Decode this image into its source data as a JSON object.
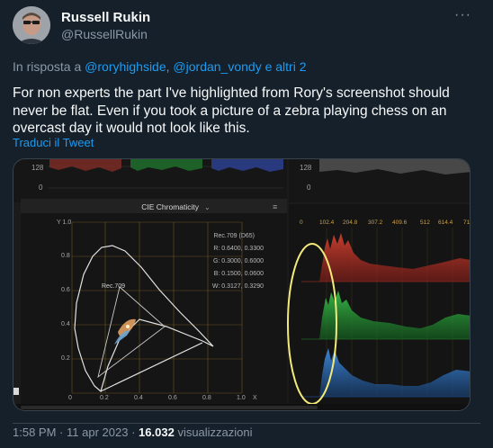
{
  "tweet": {
    "author_name": "Russell Rukin",
    "author_handle": "@RussellRukin",
    "more_glyph": "···",
    "reply_prefix": "In risposta a",
    "reply_mention_1": "@roryhighside",
    "reply_sep": ",",
    "reply_mention_2": "@jordan_vondy",
    "reply_suffix": "e altri 2",
    "text": "For non experts the part I've highlighted from Rory's screenshot should never be flat. Even if you took a picture of a zebra playing chess on an overcast day it would not look like this.",
    "translate_label": "Traduci il Tweet",
    "time": "1:58 PM",
    "date": "11 apr 2023",
    "meta_sep": "·",
    "views_count": "16.032",
    "views_label": "visualizzazioni"
  },
  "screenshot": {
    "left_top_scale": [
      "128",
      "0"
    ],
    "right_top_scale": [
      "128",
      "0"
    ],
    "panel_title": "CIE Chromaticity",
    "y_axis_label": "Y 1.0",
    "y_ticks": [
      "0.8",
      "0.6",
      "0.4",
      "0.2"
    ],
    "x_ticks": [
      "0",
      "0.2",
      "0.4",
      "0.6",
      "0.8",
      "1.0",
      "X"
    ],
    "gamut_label": "Rec.709",
    "legend": [
      "Rec.709 (D65)",
      "R: 0.6400, 0.3300",
      "G: 0.3000, 0.6000",
      "B: 0.1500, 0.0600",
      "W: 0.3127, 0.3290"
    ],
    "histogram_scale": [
      "0",
      "102.4",
      "204.8",
      "307.2",
      "409.6",
      "512",
      "614.4",
      "71"
    ],
    "colors": {
      "red": "#c0392b",
      "green": "#27ae3a",
      "blue": "#2f78c4",
      "highlight": "#f3ea7a"
    }
  }
}
